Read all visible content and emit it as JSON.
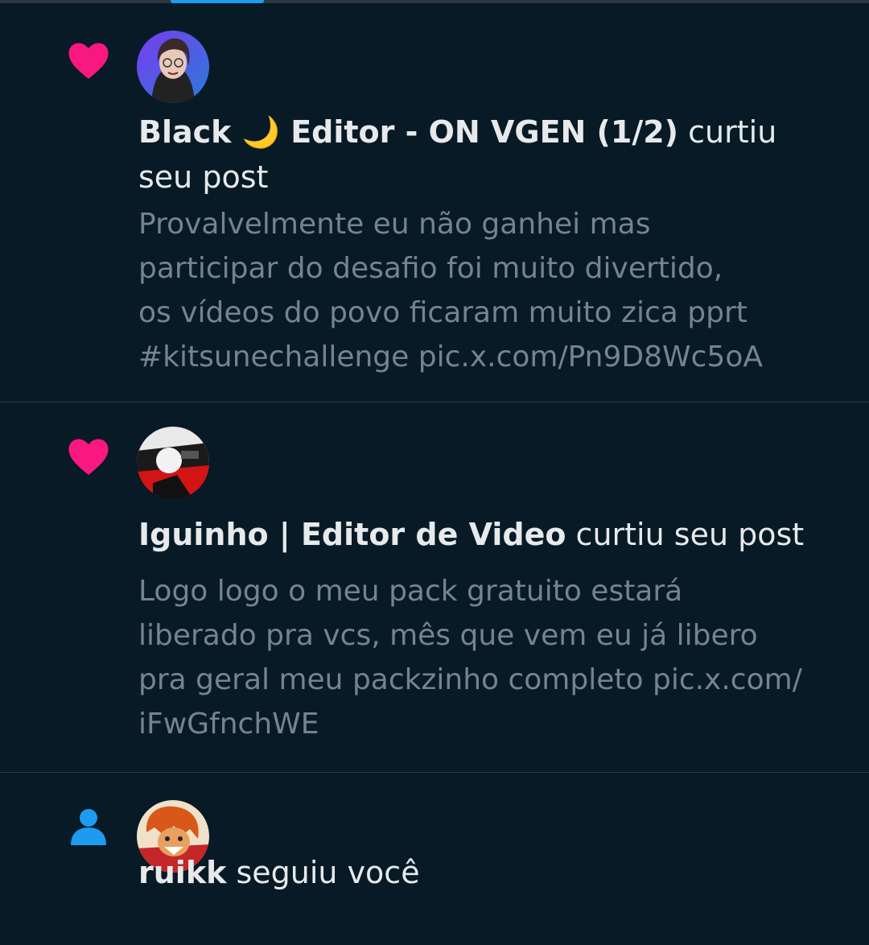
{
  "notifications": [
    {
      "kind_icon": "heart-icon",
      "user": "Black 🌙 Editor - ON VGEN (1/2)",
      "action": "curtiu seu post",
      "post_excerpt": "Provalvelmente eu não ganhei mas\nparticipar do desafio foi muito divertido,\nos vídeos do povo ficaram muito zica pprt\n#kitsunechallenge pic.x.com/Pn9D8Wc5oA"
    },
    {
      "kind_icon": "heart-icon",
      "user": "Iguinho | Editor de Video",
      "action": "curtiu seu post",
      "post_excerpt": "Logo logo o meu pack gratuito estará\nliberado pra vcs, mês que vem eu já libero\npra geral meu packzinho completo pic.x.com/\niFwGfnchWE"
    },
    {
      "kind_icon": "person-icon",
      "user": "ruikk",
      "action": "seguiu você"
    }
  ],
  "colors": {
    "background": "#071a26",
    "heart": "#f91880",
    "follow": "#1d9bf0",
    "primary_text": "#e7e9ea",
    "secondary_text": "#77838d"
  }
}
